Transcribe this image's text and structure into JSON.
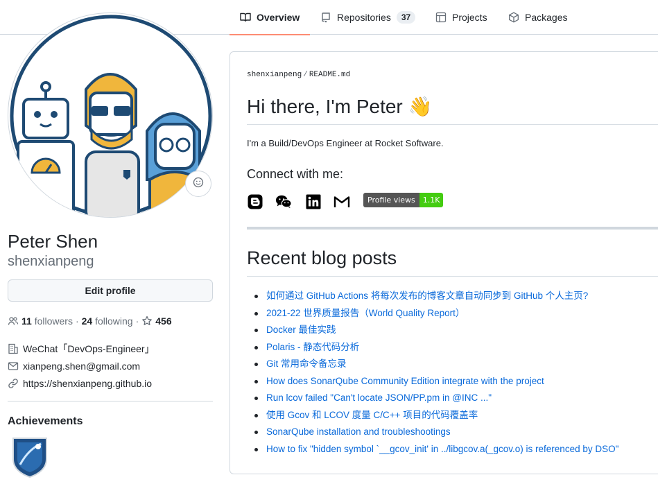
{
  "nav": {
    "tabs": [
      {
        "label": "Overview",
        "icon": "book-icon"
      },
      {
        "label": "Repositories",
        "icon": "repo-icon",
        "count": "37"
      },
      {
        "label": "Projects",
        "icon": "table-icon"
      },
      {
        "label": "Packages",
        "icon": "package-icon"
      }
    ]
  },
  "profile": {
    "name": "Peter Shen",
    "username": "shenxianpeng",
    "edit_label": "Edit profile",
    "followers_count": "11",
    "followers_label": "followers",
    "following_count": "24",
    "following_label": "following",
    "stars": "456",
    "details": [
      {
        "icon": "organization-icon",
        "text": "WeChat「DevOps-Engineer」"
      },
      {
        "icon": "mail-icon",
        "text": "xianpeng.shen@gmail.com"
      },
      {
        "icon": "link-icon",
        "text": "https://shenxianpeng.github.io"
      }
    ],
    "achievements_title": "Achievements"
  },
  "readme": {
    "owner": "shenxianpeng",
    "file": "README.md",
    "greeting": "Hi there, I'm Peter 👋",
    "intro": "I'm a Build/DevOps Engineer at Rocket Software.",
    "connect_title": "Connect with me:",
    "social_icons": [
      "blogger-icon",
      "wechat-icon",
      "linkedin-icon",
      "gmail-icon"
    ],
    "profile_views_label": "Profile views",
    "profile_views_value": "1.1K",
    "posts_title": "Recent blog posts",
    "posts": [
      "如何通过 GitHub Actions 将每次发布的博客文章自动同步到 GitHub 个人主页?",
      "2021-22 世界质量报告（World Quality Report）",
      "Docker 最佳实践",
      "Polaris - 静态代码分析",
      "Git 常用命令备忘录",
      "How does SonarQube Community Edition integrate with the project",
      "Run lcov failed \"Can't locate JSON/PP.pm in @INC ...\"",
      "使用 Gcov 和 LCOV 度量 C/C++ 项目的代码覆盖率",
      "SonarQube installation and troubleshootings",
      "How to fix \"hidden symbol `__gcov_init' in ../libgcov.a(_gcov.o) is referenced by DSO\""
    ]
  },
  "colors": {
    "link": "#0969da",
    "tab_underline": "#fd8c73",
    "views_badge": "#4c1"
  }
}
